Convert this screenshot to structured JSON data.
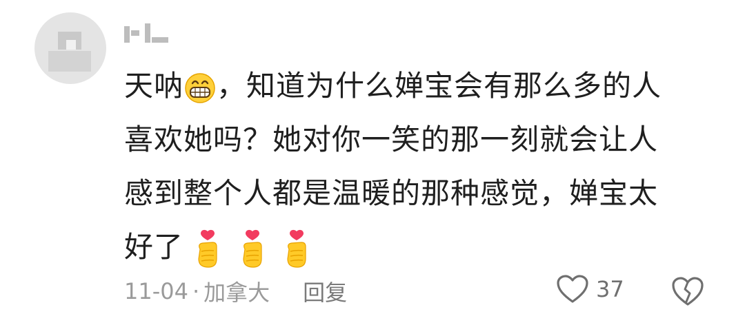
{
  "comment": {
    "author_name": "",
    "line1_a": "天呐",
    "line1_b": "，知道为什么婵宝会有那么多的人",
    "line2": "喜欢她吗？她对你一笑的那一刻就会让人",
    "line3": "感到整个人都是温暖的那种感觉，婵宝太",
    "line4": "好了",
    "date": "11-04",
    "separator": "·",
    "location": "加拿大",
    "reply_label": "回复",
    "like_count": "37",
    "icons": [
      "grinning-face-emoji",
      "finger-heart-emoji",
      "heart-outline-icon",
      "broken-heart-icon"
    ]
  }
}
